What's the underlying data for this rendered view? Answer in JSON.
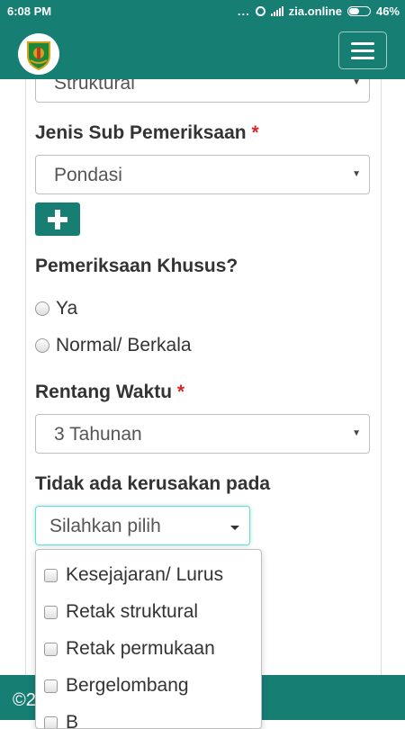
{
  "status_bar": {
    "time": "6:08 PM",
    "dots": "...",
    "carrier": "zia.online",
    "battery": "46%"
  },
  "navbar": {
    "logo_icon": "regional-emblem-icon",
    "menu_icon": "hamburger-menu-icon"
  },
  "form": {
    "struktur_select": {
      "value": "Struktural"
    },
    "jenis_sub": {
      "label": "Jenis Sub Pemeriksaan",
      "required_mark": "*",
      "value": "Pondasi"
    },
    "add_button_icon": "plus-icon",
    "khusus": {
      "label": "Pemeriksaan Khusus?",
      "options": [
        "Ya",
        "Normal/ Berkala"
      ]
    },
    "rentang": {
      "label": "Rentang Waktu",
      "required_mark": "*",
      "value": "3 Tahunan"
    },
    "kerusakan": {
      "label": "Tidak ada kerusakan pada",
      "placeholder": "Silahkan pilih",
      "options": [
        "Kesejajaran/ Lurus",
        "Retak struktural",
        "Retak permukaan",
        "Bergelombang",
        "B"
      ]
    }
  },
  "footer": {
    "text": "©2"
  },
  "colors": {
    "primary": "#177e73",
    "required": "#d9262d",
    "focus": "#66e0d0"
  }
}
